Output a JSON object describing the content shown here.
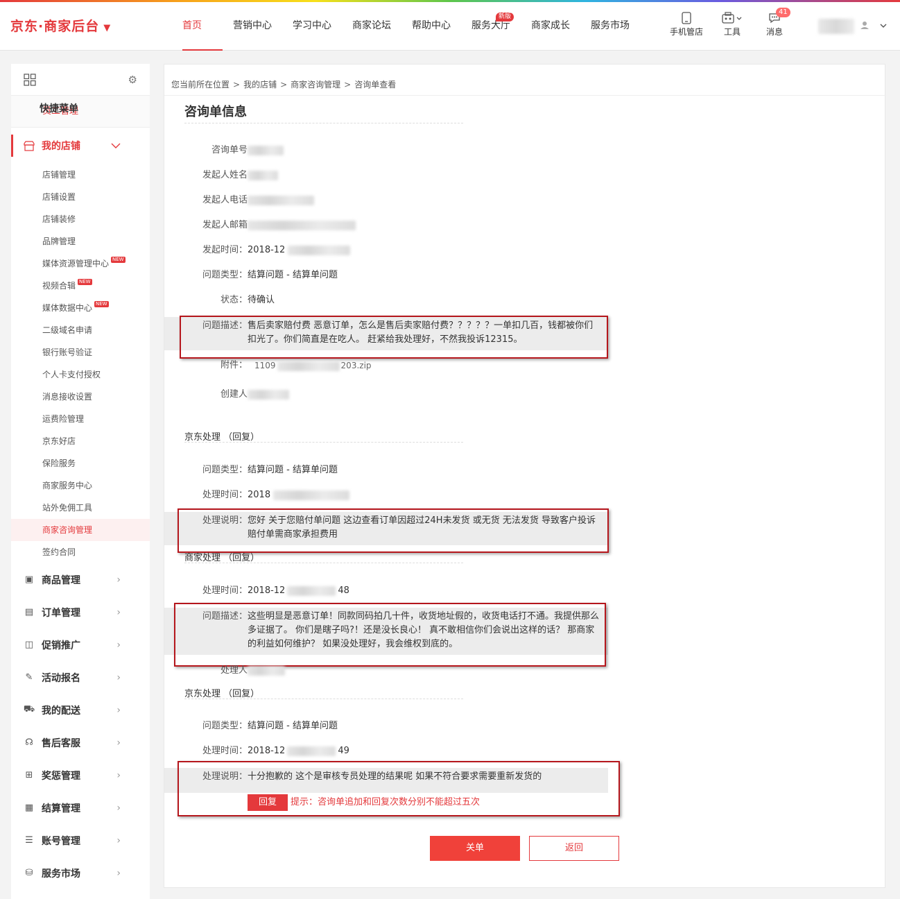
{
  "header": {
    "logo": "京东·商家后台",
    "logo_caret": "▼",
    "nav": [
      "首页",
      "营销中心",
      "学习中心",
      "商家论坛",
      "帮助中心",
      "服务大厅",
      "商家成长",
      "服务市场"
    ],
    "nav_badge": "新版",
    "tools": {
      "mobile": "手机管店",
      "tool": "工具",
      "message": "消息",
      "message_count": "41"
    }
  },
  "sidebar": {
    "quick_menu": "快捷菜单",
    "quick_item": "员工管理",
    "my_store": "我的店铺",
    "store_items": [
      "店铺管理",
      "店铺设置",
      "店铺装修",
      "品牌管理",
      "媒体资源管理中心",
      "视频合辑",
      "媒体数据中心",
      "二级域名申请",
      "银行账号验证",
      "个人卡支付授权",
      "消息接收设置",
      "运费险管理",
      "京东好店",
      "保险服务",
      "商家服务中心",
      "站外免佣工具",
      "商家咨询管理",
      "签约合同"
    ],
    "new_tag": "NEW",
    "groups": [
      "商品管理",
      "订单管理",
      "促销推广",
      "活动报名",
      "我的配送",
      "售后客服",
      "奖惩管理",
      "结算管理",
      "账号管理",
      "服务市场"
    ]
  },
  "breadcrumb": {
    "prefix": "您当前所在位置",
    "items": [
      "我的店铺",
      "商家咨询管理",
      "咨询单查看"
    ],
    "sep": ">"
  },
  "page_title": "咨询单信息",
  "info": {
    "labels": [
      "咨询单号",
      "发起人姓名",
      "发起人电话",
      "发起人邮箱",
      "发起时间：",
      "问题类型：",
      "状态：",
      "问题描述：",
      "附件：",
      "创建人"
    ],
    "time_prefix": "2018-12",
    "problem_type": "结算问题 - 结算单问题",
    "status": "待确认",
    "description": "售后卖家赔付费 恶意订单，怎么是售后卖家赔付费？？？？？一单扣几百，钱都被你们扣光了。你们简直是在吃人。 赶紧给我处理好，不然我投诉12315。",
    "attachment_prefix": "1109",
    "attachment_suffix": "203.zip"
  },
  "jd_reply_1": {
    "title": "京东处理 （回复）",
    "type_label": "问题类型：",
    "type": "结算问题 - 结算单问题",
    "time_label": "处理时间：",
    "time": "2018",
    "note_label": "处理说明：",
    "note": "您好 关于您赔付单问题 这边查看订单因超过24H未发货 或无货 无法发货 导致客户投诉 赔付单需商家承担费用"
  },
  "merchant_reply": {
    "title": "商家处理 （回复）",
    "time_label": "处理时间：",
    "time": "2018-12",
    "time_suffix": "48",
    "desc_label": "问题描述：",
    "desc": "这些明显是恶意订单！同款同码拍几十件，收货地址假的，收货电话打不通。我提供那么多证据了。 你们是瞎子吗?！还是没长良心！ 真不敢相信你们会说出这样的话？ 那商家的利益如何维护？ 如果没处理好，我会维权到底的。",
    "handler_label": "处理人"
  },
  "jd_reply_2": {
    "title": "京东处理 （回复）",
    "type_label": "问题类型：",
    "type": "结算问题 - 结算单问题",
    "time_label": "处理时间：",
    "time": "2018-12",
    "time_suffix": "49",
    "note_label": "处理说明：",
    "note": "十分抱歉的 这个是审核专员处理的结果呢 如果不符合要求需要重新发货的"
  },
  "reply_button": "回复",
  "hint": "提示：咨询单追加和回复次数分别不能超过五次",
  "buttons": {
    "close": "关单",
    "back": "返回"
  },
  "colors": {
    "accent": "#e4393c",
    "highlight_border": "#b5161c"
  }
}
